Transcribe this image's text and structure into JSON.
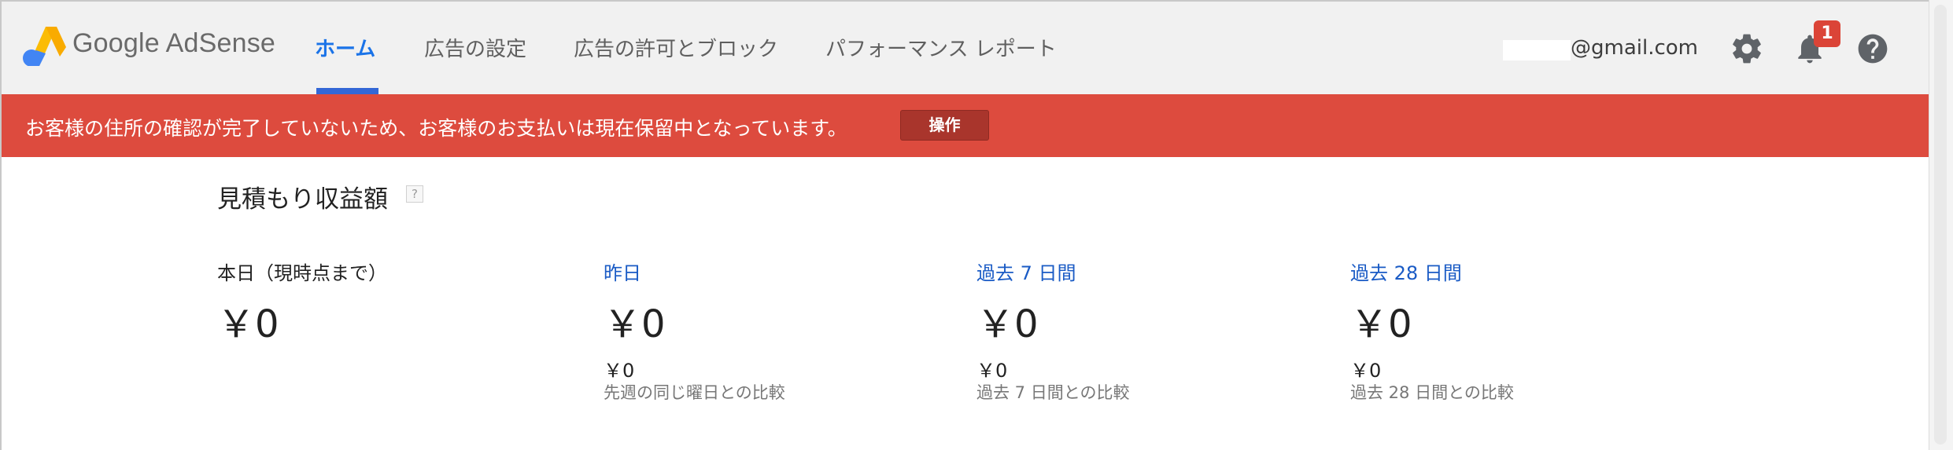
{
  "header": {
    "logo_text": "Google AdSense",
    "tabs": [
      {
        "label": "ホーム",
        "active": true
      },
      {
        "label": "広告の設定",
        "active": false
      },
      {
        "label": "広告の許可とブロック",
        "active": false
      },
      {
        "label": "パフォーマンス レポート",
        "active": false
      }
    ],
    "account_email": "@gmail.com",
    "notification_count": "1",
    "icons": [
      "adsense-logo-icon",
      "gear-icon",
      "bell-icon",
      "help-icon"
    ],
    "colors": {
      "accent": "#3367d6",
      "badge": "#db4437",
      "header_bg": "#f1f1f1"
    }
  },
  "alert": {
    "message": "お客様の住所の確認が完了していないため、お客様のお支払いは現在保留中となっています。",
    "action_label": "操作",
    "color": "#dd4b3e"
  },
  "earnings": {
    "title": "見積もり収益額",
    "help_label": "?",
    "metrics": [
      {
        "label": "本日（現時点まで）",
        "value": "￥0",
        "comparison_value": "",
        "comparison_note": ""
      },
      {
        "label": "昨日",
        "value": "￥0",
        "comparison_value": "￥0",
        "comparison_note": "先週の同じ曜日との比較"
      },
      {
        "label": "過去 7 日間",
        "value": "￥0",
        "comparison_value": "￥0",
        "comparison_note": "過去 7 日間との比較"
      },
      {
        "label": "過去 28 日間",
        "value": "￥0",
        "comparison_value": "￥0",
        "comparison_note": "過去 28 日間との比較"
      }
    ]
  }
}
